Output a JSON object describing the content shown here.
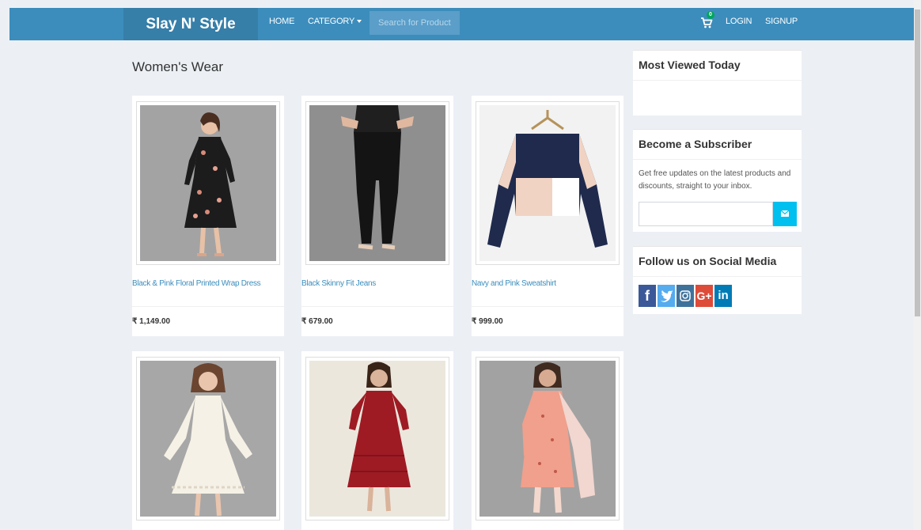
{
  "header": {
    "brand": "Slay N' Style",
    "nav_home": "HOME",
    "nav_category": "CATEGORY",
    "search_placeholder": "Search for Product",
    "cart_count": "0",
    "nav_login": "LOGIN",
    "nav_signup": "SIGNUP"
  },
  "main": {
    "title": "Women's Wear",
    "products": [
      {
        "name": "Black & Pink Floral Printed Wrap Dress",
        "price": "₹ 1,149.00"
      },
      {
        "name": "Black Skinny Fit Jeans",
        "price": "₹ 679.00"
      },
      {
        "name": "Navy and Pink Sweatshirt",
        "price": "₹ 999.00"
      }
    ]
  },
  "sidebar": {
    "most_viewed_title": "Most Viewed Today",
    "subscriber_title": "Become a Subscriber",
    "subscriber_text": "Get free updates on the latest products and discounts, straight to your inbox.",
    "social_title": "Follow us on Social Media",
    "social_icons": [
      "facebook-icon",
      "twitter-icon",
      "instagram-icon",
      "google-plus-icon",
      "linkedin-icon"
    ]
  },
  "colors": {
    "header": "#3c8dbc",
    "brand_bg": "#367fa9",
    "background": "#ecf0f5",
    "subscribe_button": "#00c0ef",
    "facebook": "#3b5998",
    "twitter": "#55acee",
    "instagram": "#3f729b",
    "google_plus": "#dd4b39",
    "linkedin": "#007bb6"
  }
}
